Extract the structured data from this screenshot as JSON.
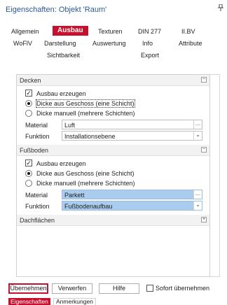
{
  "window": {
    "title": "Eigenschaften: Objekt 'Raum'",
    "pin_icon": "pin-icon"
  },
  "tabs": {
    "row1": [
      "Allgemein",
      "Ausbau",
      "Texturen",
      "DIN 277",
      "II.BV"
    ],
    "row2": [
      "WoFlV",
      "Darstellung",
      "Auswertung",
      "Info",
      "Attribute"
    ],
    "row3": [
      "Sichtbarkeit",
      "Export"
    ],
    "active": "Ausbau",
    "active_color": "#c8102e"
  },
  "decken": {
    "title": "Decken",
    "ausbau_label": "Ausbau erzeugen",
    "ausbau_checked": true,
    "option1": "Dicke aus Geschoss (eine Schicht)",
    "option2": "Dicke manuell (mehrere Schichten)",
    "selected": 1,
    "material_label": "Material",
    "material_value": "Luft",
    "funktion_label": "Funktion",
    "funktion_value": "Installationsebene"
  },
  "fussboden": {
    "title": "Fußboden",
    "ausbau_label": "Ausbau erzeugen",
    "ausbau_checked": true,
    "option1": "Dicke aus Geschoss (eine Schicht)",
    "option2": "Dicke manuell (mehrere Schichten)",
    "selected": 1,
    "material_label": "Material",
    "material_value": "Parkett",
    "funktion_label": "Funktion",
    "funktion_value": "Fußbodenaufbau",
    "highlight_color": "#a9ccef"
  },
  "dachflaechen": {
    "title": "Dachflächen"
  },
  "buttons": {
    "uebernehmen": "Übernehmen",
    "verwerfen": "Verwerfen",
    "hilfe": "Hilfe",
    "sofort": "Sofort übernehmen"
  },
  "bottom_tabs": [
    "Eigenschaften",
    "Anmerkungen"
  ]
}
